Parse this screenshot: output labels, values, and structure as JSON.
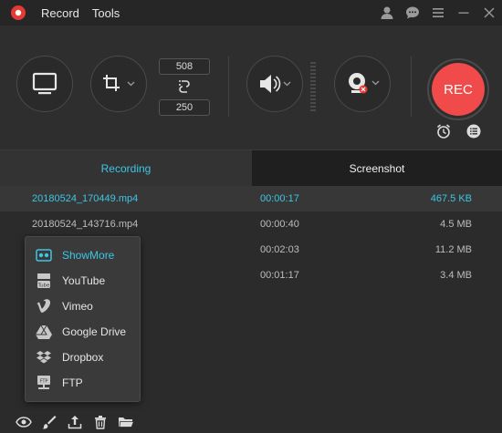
{
  "menu": {
    "record": "Record",
    "tools": "Tools"
  },
  "controls": {
    "width": "508",
    "height": "250",
    "rec_label": "REC"
  },
  "tabs": {
    "recording": "Recording",
    "screenshot": "Screenshot"
  },
  "files": [
    {
      "name": "20180524_170449.mp4",
      "duration": "00:00:17",
      "size": "467.5 KB"
    },
    {
      "name": "20180524_143716.mp4",
      "duration": "00:00:40",
      "size": "4.5 MB"
    },
    {
      "name": "",
      "duration": "00:02:03",
      "size": "11.2 MB"
    },
    {
      "name": "",
      "duration": "00:01:17",
      "size": "3.4 MB"
    }
  ],
  "share_menu": [
    {
      "label": "ShowMore",
      "icon": "showmore-icon"
    },
    {
      "label": "YouTube",
      "icon": "youtube-icon"
    },
    {
      "label": "Vimeo",
      "icon": "vimeo-icon"
    },
    {
      "label": "Google Drive",
      "icon": "google-drive-icon"
    },
    {
      "label": "Dropbox",
      "icon": "dropbox-icon"
    },
    {
      "label": "FTP",
      "icon": "ftp-icon"
    }
  ],
  "colors": {
    "accent": "#3cc6e6",
    "rec": "#f04a4a",
    "background": "#2b2b2b"
  }
}
